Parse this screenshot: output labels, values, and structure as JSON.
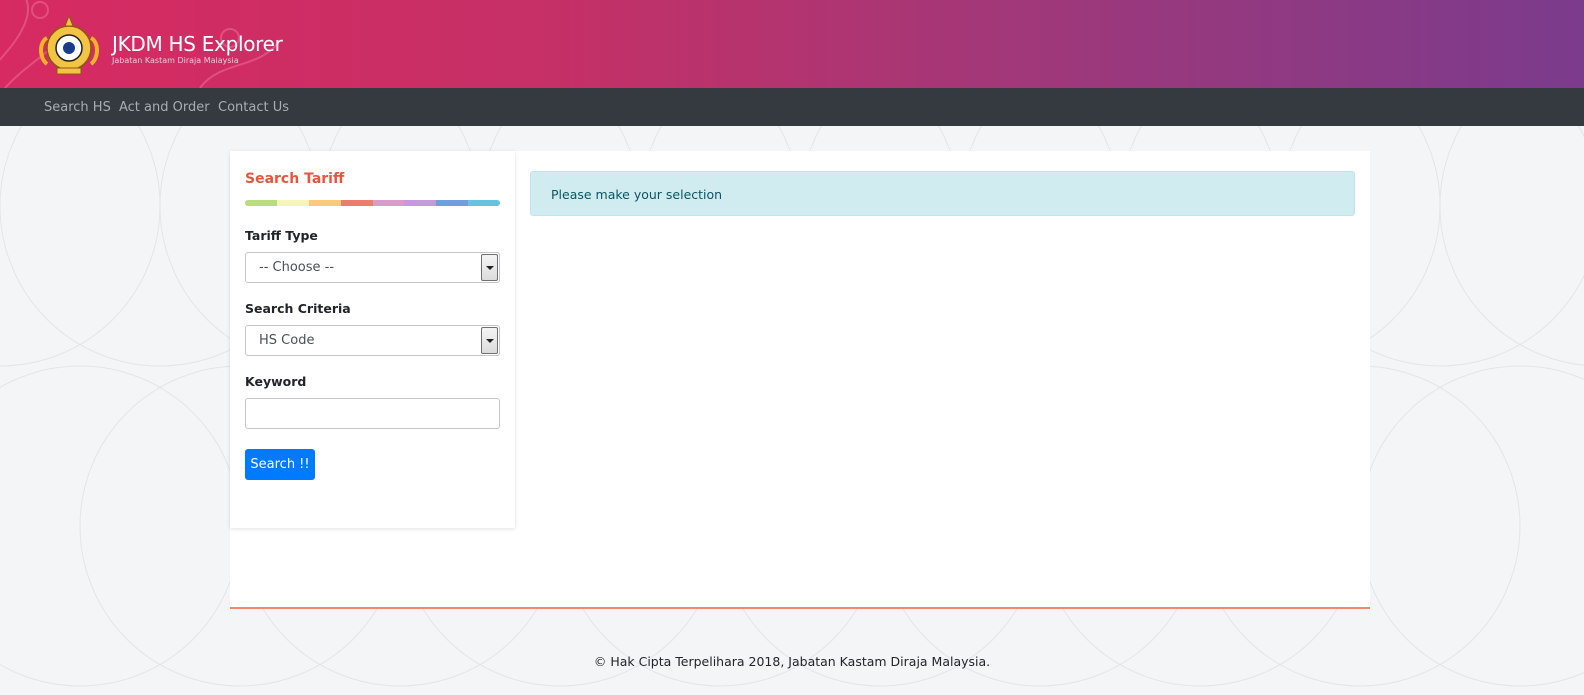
{
  "header": {
    "title": "JKDM HS Explorer",
    "subtitle": "Jabatan Kastam Diraja Malaysia",
    "logo_icon": "malaysia-coat-of-arms-icon"
  },
  "nav": {
    "items": [
      {
        "label": "Search HS"
      },
      {
        "label": "Act and Order"
      },
      {
        "label": "Contact Us"
      }
    ]
  },
  "search_panel": {
    "title": "Search Tariff",
    "tariff_type": {
      "label": "Tariff Type",
      "selected": "-- Choose --"
    },
    "search_criteria": {
      "label": "Search Criteria",
      "selected": "HS Code"
    },
    "keyword": {
      "label": "Keyword",
      "value": "",
      "placeholder": ""
    },
    "search_button": "Search !!"
  },
  "alert": {
    "message": "Please make your selection"
  },
  "footer": {
    "copyright": "© Hak Cipta Terpelihara 2018, Jabatan Kastam Diraja Malaysia."
  },
  "colors": {
    "banner_start": "#d72a62",
    "banner_end": "#7b3b8c",
    "navbar": "#343a40",
    "panel_title": "#e8553e",
    "primary_button": "#007bff",
    "alert_bg": "#d1ecf1",
    "rainbow": [
      "#b9dd7e",
      "#f3f6b6",
      "#fbc97a",
      "#ed7d6b",
      "#d99bc8",
      "#c39bdd",
      "#6f9ee0",
      "#66c2e3"
    ]
  }
}
